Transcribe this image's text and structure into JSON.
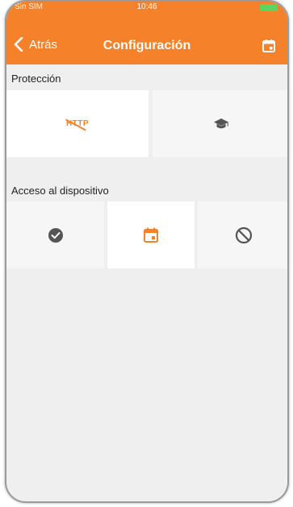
{
  "status_bar": {
    "carrier": "Sin SIM",
    "time": "10:46"
  },
  "nav": {
    "back_label": "Atrás",
    "title": "Configuración",
    "icon": "calendar-icon"
  },
  "protection": {
    "label": "Protección",
    "options": [
      {
        "name": "http-blocker",
        "text": "HTTP",
        "icon": "http-crossed-icon",
        "selected": true
      },
      {
        "name": "education",
        "icon": "graduation-cap-icon",
        "selected": false
      }
    ]
  },
  "device_access": {
    "label": "Acceso al dispositivo",
    "options": [
      {
        "name": "allowed",
        "icon": "check-circle-icon",
        "selected": false
      },
      {
        "name": "scheduled",
        "icon": "calendar-icon",
        "selected": true
      },
      {
        "name": "blocked",
        "icon": "block-icon",
        "selected": false
      }
    ]
  },
  "colors": {
    "accent": "#f5822a",
    "icon_gray": "#555555",
    "background": "#efefef"
  }
}
